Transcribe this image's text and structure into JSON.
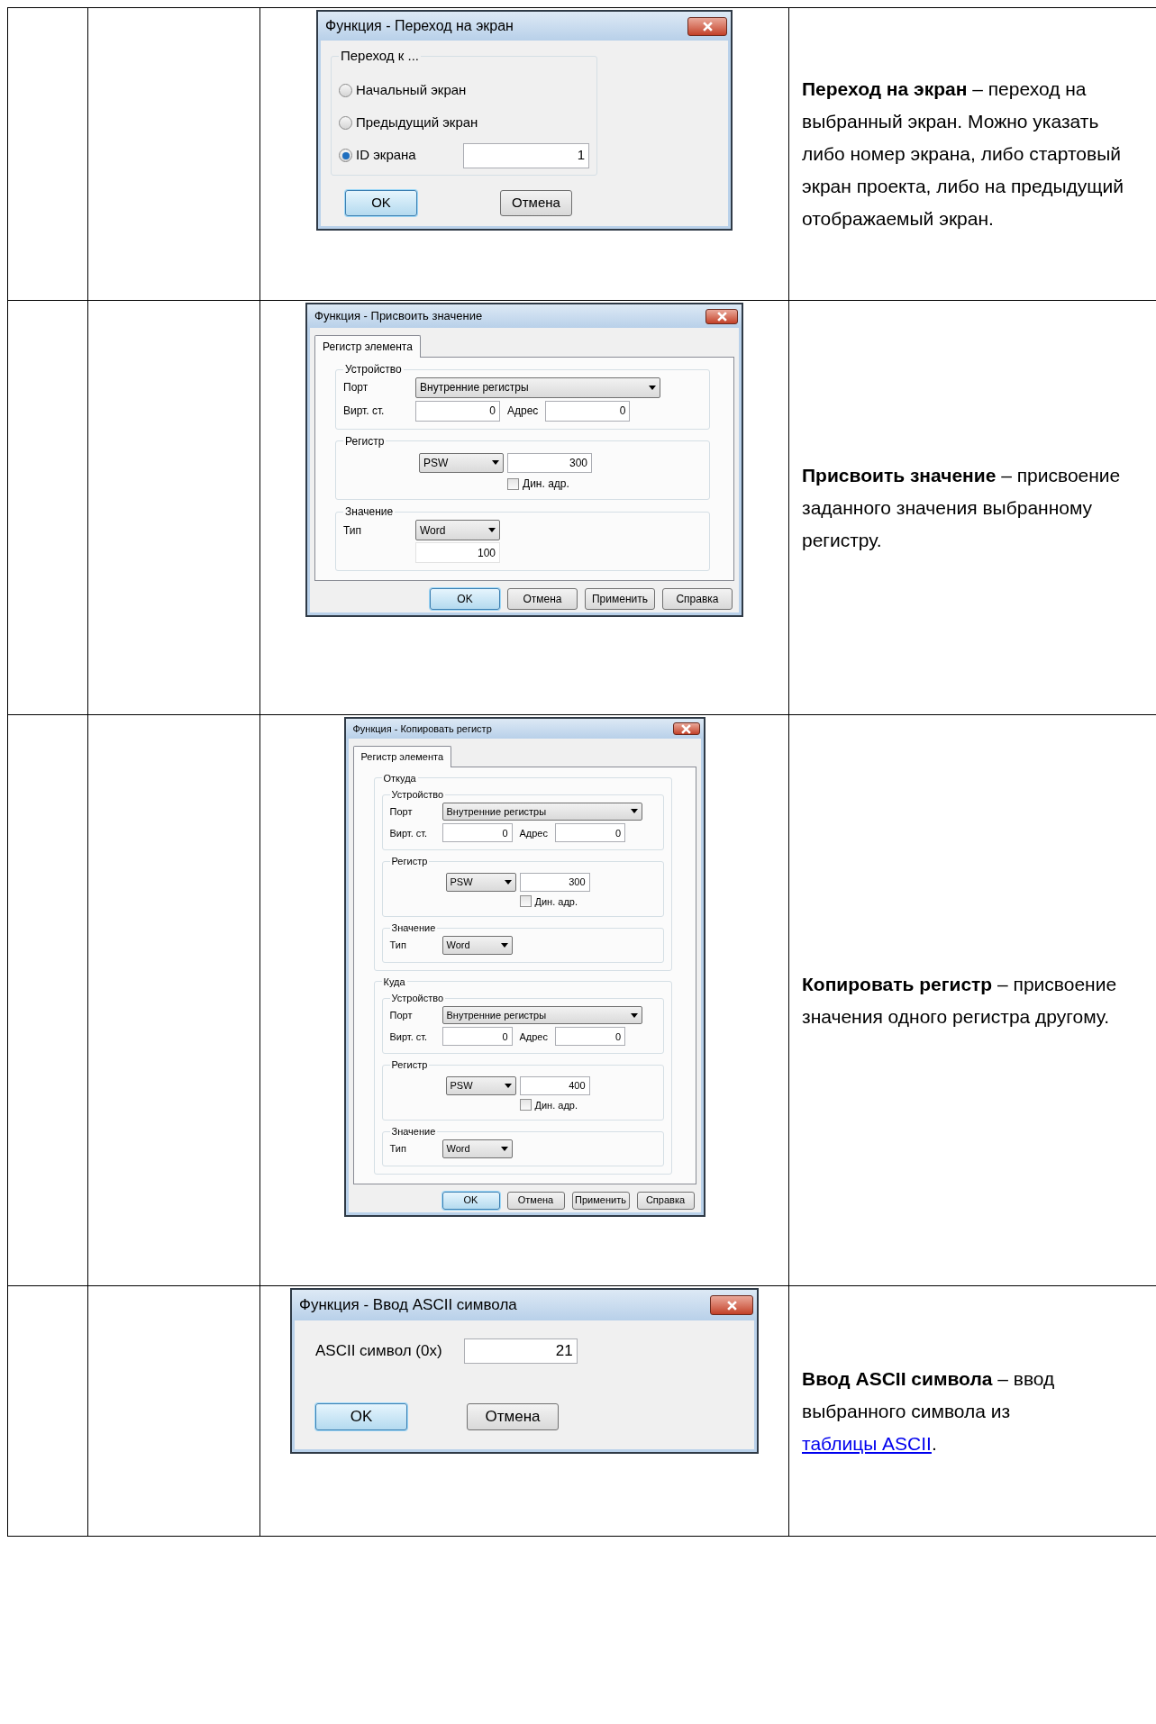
{
  "table": {
    "rows": [
      {
        "dialog": {
          "kind": "goto_screen",
          "title": "Функция - Переход на экран",
          "group_label": "Переход к ...",
          "radios": [
            {
              "label": "Начальный экран",
              "selected": false
            },
            {
              "label": "Предыдущий экран",
              "selected": false
            },
            {
              "label": "ID экрана",
              "selected": true,
              "value": "1"
            }
          ],
          "buttons": [
            {
              "label": "OK",
              "default": true
            },
            {
              "label": "Отмена",
              "default": false
            }
          ]
        },
        "description": {
          "text": "**Переход на экран** – переход на выбранный экран. Можно указать либо номер экрана, либо стартовый экран проекта, либо на предыдущий отображаемый экран."
        }
      },
      {
        "dialog": {
          "kind": "assign_value",
          "title": "Функция - Присвоить значение",
          "tabs": [
            {
              "label": "Регистр элемента",
              "selected": true
            }
          ],
          "groups": [
            {
              "kind": "device",
              "label": "Устройство",
              "port_label": "Порт",
              "port": "Внутренние регистры",
              "station_label": "Вирт. ст.",
              "station": "0",
              "address_label": "Адрес",
              "address": "0"
            },
            {
              "kind": "register",
              "label": "Регистр",
              "type": "PSW",
              "address": "300",
              "dynamic_label": "Дин. адр.",
              "dynamic": false
            },
            {
              "kind": "value",
              "label": "Значение",
              "type_label": "Тип",
              "type": "Word",
              "value": "100"
            }
          ],
          "buttons": [
            {
              "label": "OK",
              "default": true
            },
            {
              "label": "Отмена",
              "default": false
            },
            {
              "label": "Применить",
              "default": false
            },
            {
              "label": "Справка",
              "default": false
            }
          ]
        },
        "description": {
          "text": "**Присвоить значение** – присвоение заданного значения выбранному регистру."
        }
      },
      {
        "dialog": {
          "kind": "copy_register",
          "title": "Функция - Копировать регистр",
          "tabs": [
            {
              "label": "Регистр элемента",
              "selected": true
            }
          ],
          "groups": [
            {
              "kind": "container",
              "label": "Откуда",
              "groups": [
                {
                  "kind": "device",
                  "label": "Устройство",
                  "port_label": "Порт",
                  "port": "Внутренние регистры",
                  "station_label": "Вирт. ст.",
                  "station": "0",
                  "address_label": "Адрес",
                  "address": "0"
                },
                {
                  "kind": "register",
                  "label": "Регистр",
                  "type": "PSW",
                  "address": "300",
                  "dynamic_label": "Дин. адр.",
                  "dynamic": false
                },
                {
                  "kind": "value",
                  "label": "Значение",
                  "type_label": "Тип",
                  "type": "Word"
                }
              ]
            },
            {
              "kind": "container",
              "label": "Куда",
              "groups": [
                {
                  "kind": "device",
                  "label": "Устройство",
                  "port_label": "Порт",
                  "port": "Внутренние регистры",
                  "station_label": "Вирт. ст.",
                  "station": "0",
                  "address_label": "Адрес",
                  "address": "0"
                },
                {
                  "kind": "register",
                  "label": "Регистр",
                  "type": "PSW",
                  "address": "400",
                  "dynamic_label": "Дин. адр.",
                  "dynamic": false
                },
                {
                  "kind": "value",
                  "label": "Значение",
                  "type_label": "Тип",
                  "type": "Word"
                }
              ]
            }
          ],
          "buttons": [
            {
              "label": "OK",
              "default": true
            },
            {
              "label": "Отмена",
              "default": false
            },
            {
              "label": "Применить",
              "default": false
            },
            {
              "label": "Справка",
              "default": false
            }
          ]
        },
        "description": {
          "text": "**Копировать регистр** – присвоение значения одного регистра другому."
        }
      },
      {
        "dialog": {
          "kind": "ascii_input",
          "title": "Функция - Ввод ASCII символа",
          "field_label": "ASCII символ (0x)",
          "value": "21",
          "buttons": [
            {
              "label": "OK",
              "default": true
            },
            {
              "label": "Отмена",
              "default": false
            }
          ]
        },
        "description": {
          "text": "**Ввод ASCII символа** – ввод выбранного символа из ",
          "link": "таблицы ASCII",
          "after": "."
        }
      }
    ]
  }
}
